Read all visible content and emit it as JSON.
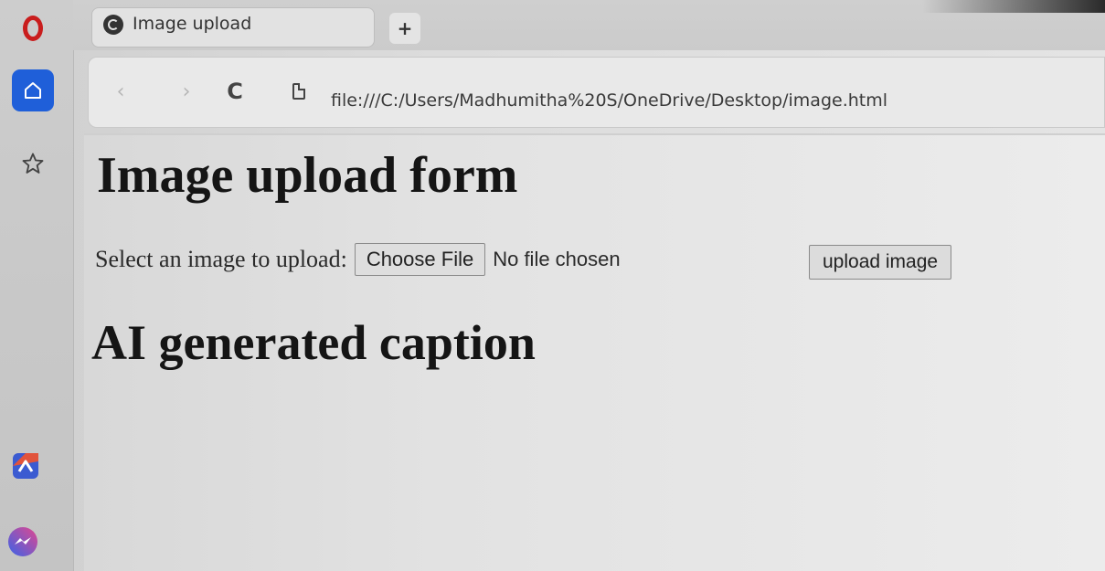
{
  "browser": {
    "tab": {
      "title": "Image upload"
    },
    "new_tab_label": "+",
    "address_bar": {
      "url": "file:///C:/Users/Madhumitha%20S/OneDrive/Desktop/image.html"
    },
    "icons": {
      "back": "‹",
      "forward": "›",
      "reload": "C"
    },
    "colors": {
      "opera_red": "#c91d1d",
      "home_blue": "#1f5fd9"
    }
  },
  "page": {
    "heading": "Image upload form",
    "form": {
      "label": "Select an image to upload:",
      "choose_file_label": "Choose File",
      "file_status": "No file chosen",
      "submit_label": "upload image"
    },
    "caption_heading": "AI generated caption"
  }
}
